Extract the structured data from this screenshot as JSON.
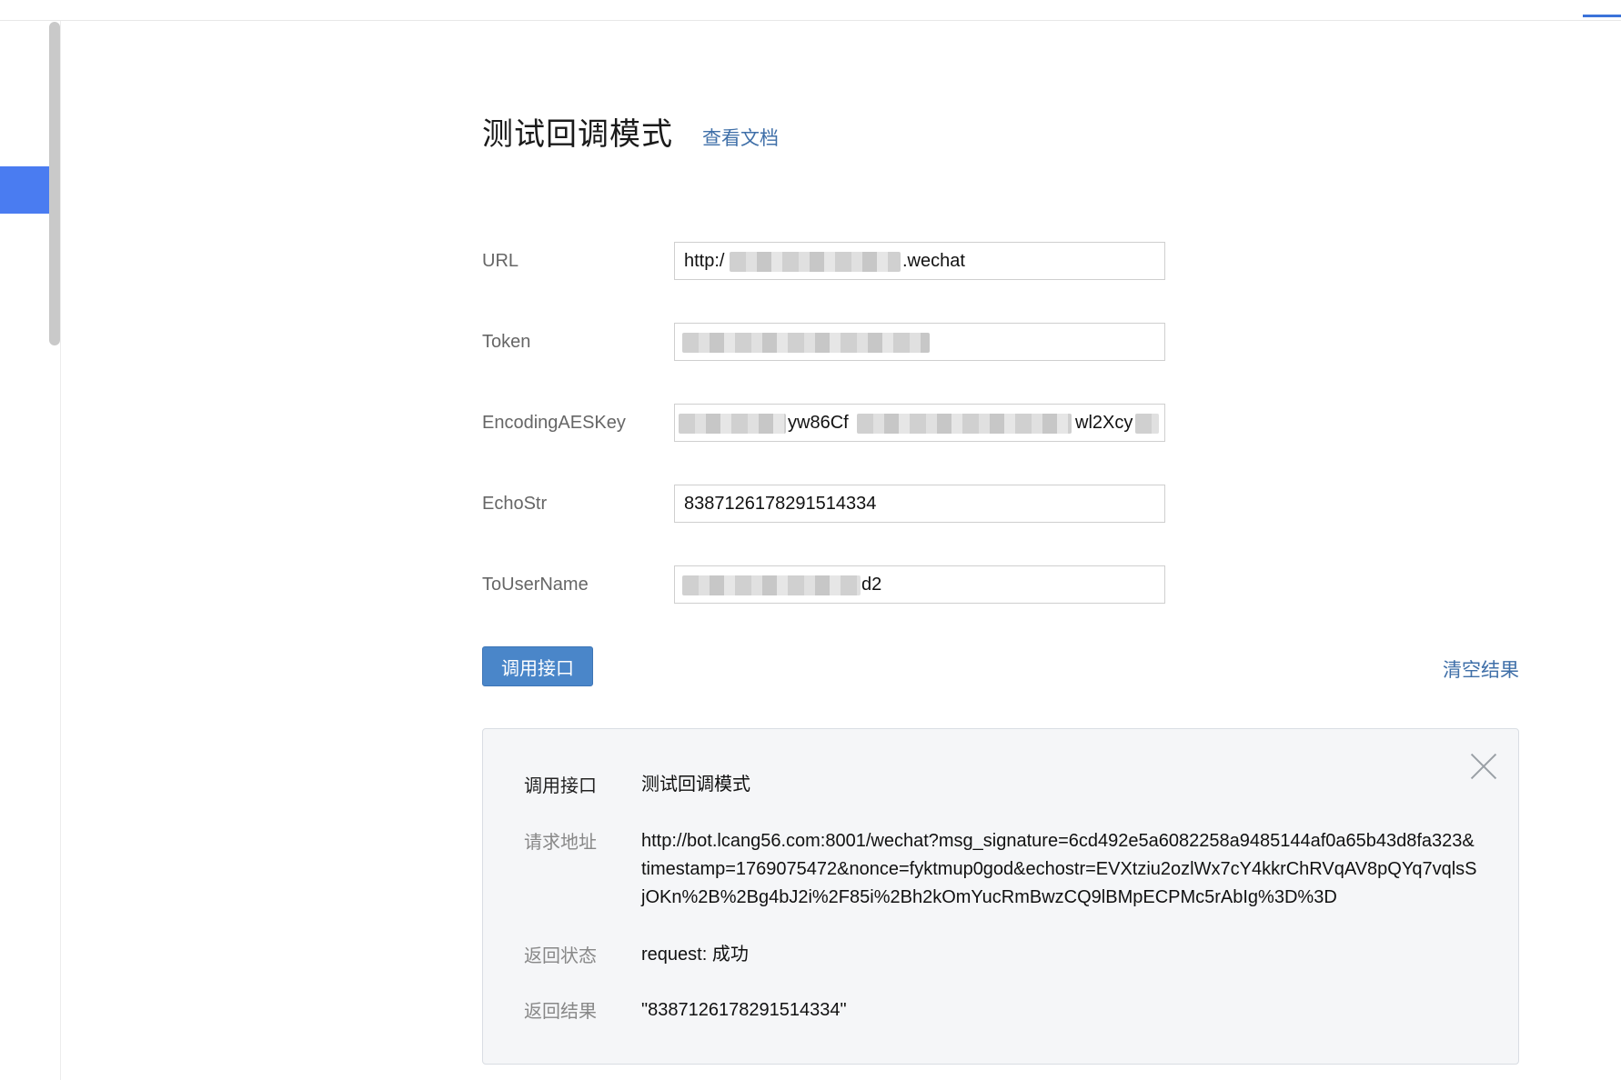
{
  "header": {
    "title": "测试回调模式",
    "doc_link": "查看文档"
  },
  "form": {
    "url": {
      "label": "URL",
      "value_start": "http:/",
      "value_end": ".wechat"
    },
    "token": {
      "label": "Token",
      "value": ""
    },
    "aes_key": {
      "label": "EncodingAESKey",
      "value_mid": "yw86Cf",
      "value_end": "wl2Xcy"
    },
    "echostr": {
      "label": "EchoStr",
      "value": "8387126178291514334"
    },
    "to_user": {
      "label": "ToUserName",
      "value_end": "d2"
    }
  },
  "actions": {
    "call_button": "调用接口",
    "clear_link": "清空结果"
  },
  "result": {
    "api_label": "调用接口",
    "api_value": "测试回调模式",
    "url_label": "请求地址",
    "url_value": "http://bot.lcang56.com:8001/wechat?msg_signature=6cd492e5a6082258a9485144af0a65b43d8fa323&timestamp=1769075472&nonce=fyktmup0god&echostr=EVXtziu2ozlWx7cY4kkrChRVqAV8pQYq7vqlsSjOKn%2B%2Bg4bJ2i%2F85i%2Bh2kOmYucRmBwzCQ9lBMpECPMc5rAbIg%3D%3D",
    "status_label": "返回状态",
    "status_value": "request: 成功",
    "return_label": "返回结果",
    "return_value": "\"8387126178291514334\""
  },
  "icons": {
    "close": "close-icon"
  },
  "colors": {
    "accent": "#4a7cf1",
    "button": "#4a86c9",
    "link": "#3f6fa8"
  }
}
